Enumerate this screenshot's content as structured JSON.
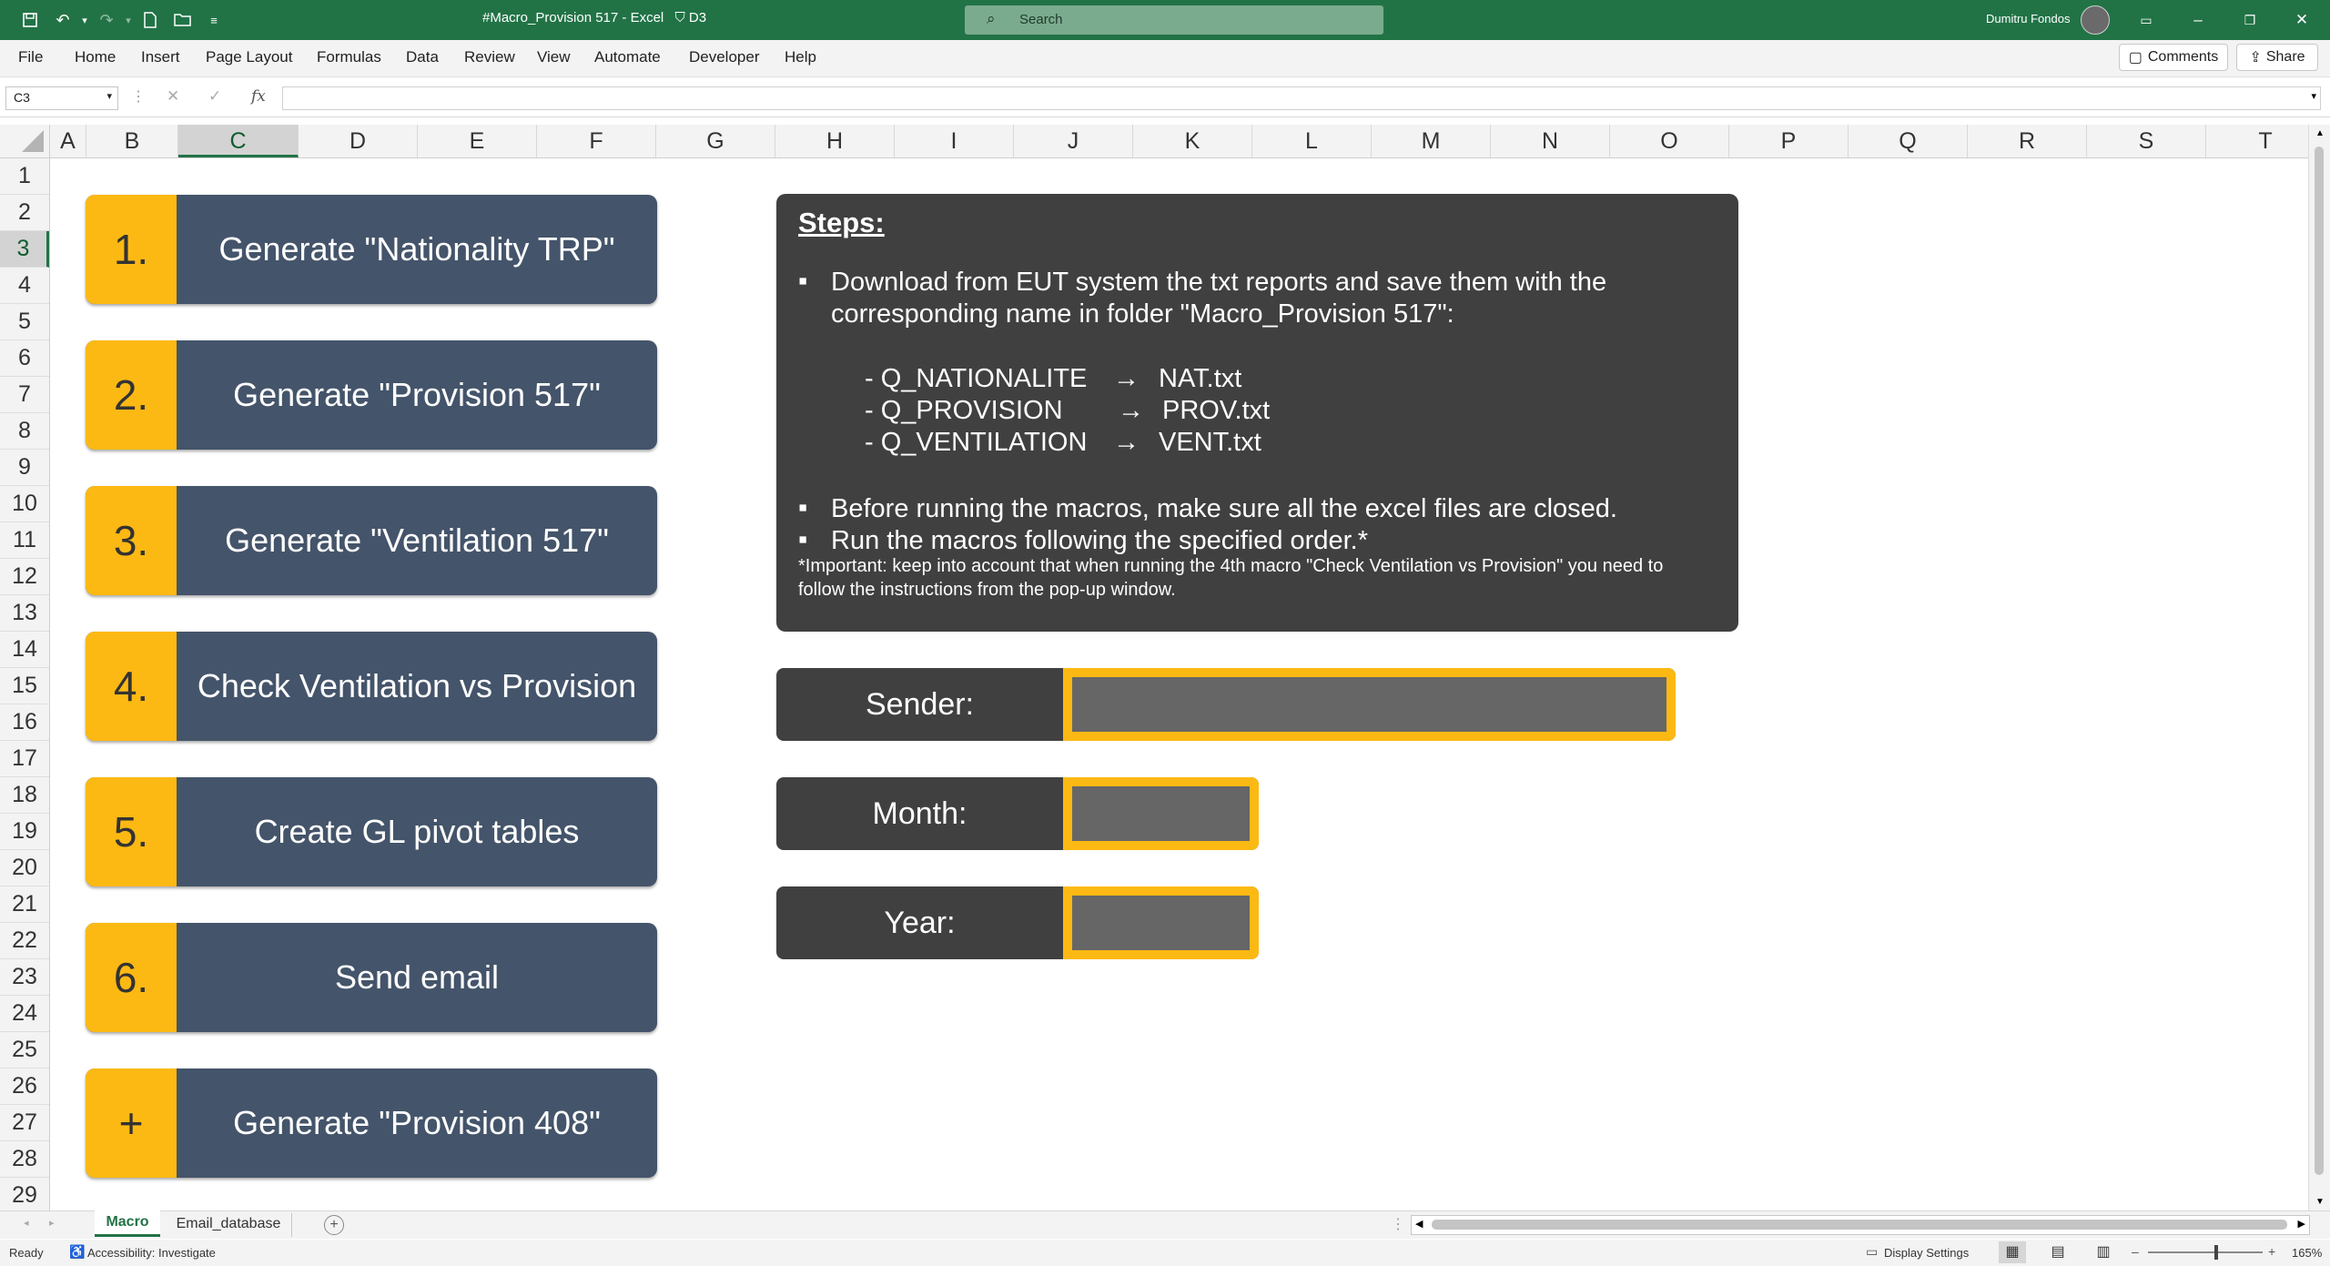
{
  "titlebar": {
    "title": "#Macro_Provision 517  -  Excel",
    "sensitivity": "D3",
    "search_placeholder": "Search",
    "user": "Dumitru Fondos"
  },
  "menu": {
    "items": [
      "File",
      "Home",
      "Insert",
      "Page Layout",
      "Formulas",
      "Data",
      "Review",
      "View",
      "Automate",
      "Developer",
      "Help"
    ],
    "comments": "Comments",
    "share": "Share"
  },
  "formula_bar": {
    "name_box": "C3",
    "fx": "fx",
    "formula": ""
  },
  "grid": {
    "columns": [
      "A",
      "B",
      "C",
      "D",
      "E",
      "F",
      "G",
      "H",
      "I",
      "J",
      "K",
      "L",
      "M",
      "N",
      "O",
      "P",
      "Q",
      "R",
      "S",
      "T"
    ],
    "selected_column": "C",
    "rows": [
      "1",
      "2",
      "3",
      "4",
      "5",
      "6",
      "7",
      "8",
      "9",
      "10",
      "11",
      "12",
      "13",
      "14",
      "15",
      "16",
      "17",
      "18",
      "19",
      "20",
      "21",
      "22",
      "23",
      "24",
      "25",
      "26",
      "27",
      "28",
      "29"
    ],
    "selected_row": "3"
  },
  "macros": [
    {
      "num": "1.",
      "label": "Generate \"Nationality TRP\""
    },
    {
      "num": "2.",
      "label": "Generate \"Provision 517\""
    },
    {
      "num": "3.",
      "label": "Generate \"Ventilation 517\""
    },
    {
      "num": "4.",
      "label": "Check Ventilation vs Provision"
    },
    {
      "num": "5.",
      "label": "Create GL pivot tables"
    },
    {
      "num": "6.",
      "label": "Send email"
    },
    {
      "num": "+",
      "label": "Generate \"Provision 408\""
    }
  ],
  "steps": {
    "heading": "Steps:",
    "bullet1_line1": "Download from EUT system the txt reports and save them with the",
    "bullet1_line2": "corresponding name in folder \"Macro_Provision 517\":",
    "mappings": [
      {
        "from": "- Q_NATIONALITE",
        "arrow": "→",
        "to": "NAT.txt"
      },
      {
        "from": "- Q_PROVISION",
        "arrow": "→",
        "to": "PROV.txt"
      },
      {
        "from": "- Q_VENTILATION",
        "arrow": "→",
        "to": "VENT.txt"
      }
    ],
    "bullet2": "Before running the macros, make sure all the excel files are closed.",
    "bullet3": "Run the macros following the specified order.*",
    "note": "*Important: keep into account that when running the 4th macro \"Check Ventilation vs Provision\" you need to follow the instructions from the pop-up window."
  },
  "inputs": {
    "sender": {
      "label": "Sender:",
      "value": ""
    },
    "month": {
      "label": "Month:",
      "value": ""
    },
    "year": {
      "label": "Year:",
      "value": ""
    }
  },
  "sheets": {
    "active": "Macro",
    "other": "Email_database"
  },
  "status": {
    "ready": "Ready",
    "accessibility": "Accessibility: Investigate",
    "display_settings": "Display Settings",
    "zoom": "165%"
  }
}
